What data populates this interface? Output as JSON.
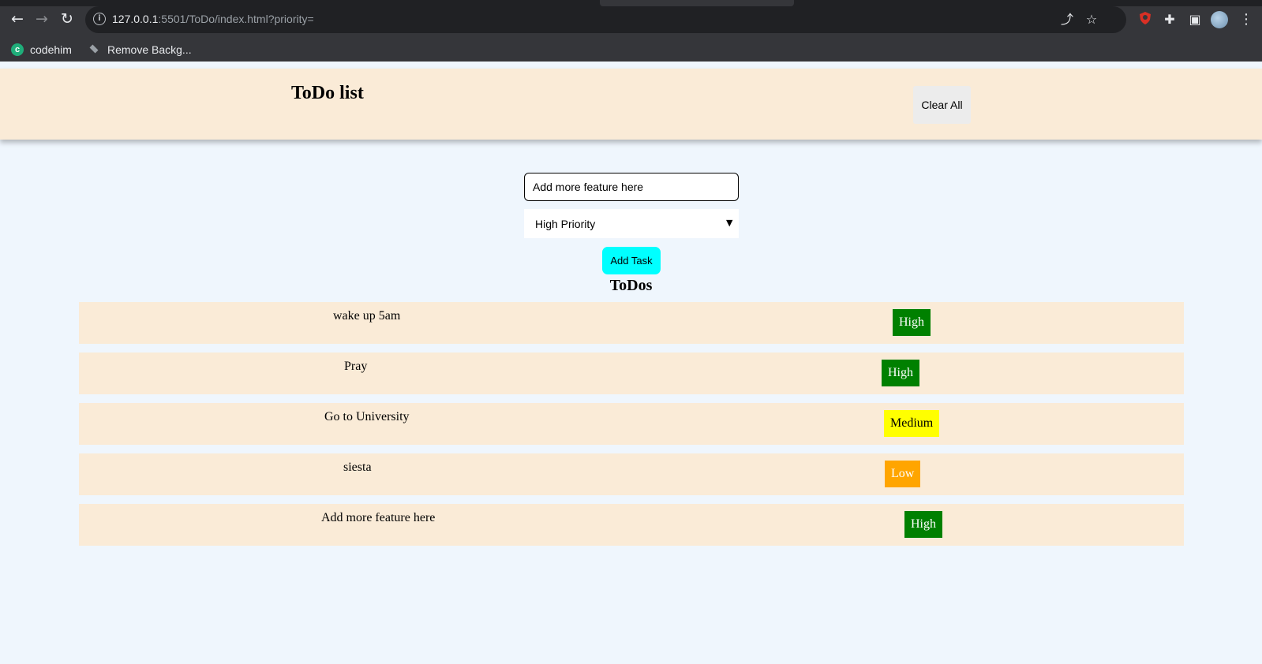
{
  "browser": {
    "url_host": "127.0.0.1",
    "url_path": ":5501/ToDo/index.html?priority=",
    "bookmarks": [
      {
        "label": "codehim",
        "icon": "codehim-logo-icon"
      },
      {
        "label": "Remove Backg...",
        "icon": "layers-icon"
      }
    ],
    "icons": {
      "back": "←",
      "forward": "→",
      "reload": "↻",
      "info": "i",
      "share": "⤴",
      "star": "☆",
      "extension_puzzle": "✚",
      "sidepanel": "▣",
      "menu": "⋮"
    }
  },
  "header": {
    "title": "ToDo list",
    "clear_label": "Clear All"
  },
  "form": {
    "input_value": "Add more feature here",
    "priority_selected": "High Priority",
    "add_label": "Add Task"
  },
  "list": {
    "heading": "ToDos",
    "items": [
      {
        "text": "wake up 5am",
        "priority": "High",
        "color": "#008000"
      },
      {
        "text": "Pray",
        "priority": "High",
        "color": "#008000"
      },
      {
        "text": "Go to University",
        "priority": "Medium",
        "color": "#ffff00"
      },
      {
        "text": "siesta",
        "priority": "Low",
        "color": "#ffa500"
      },
      {
        "text": "Add more feature here",
        "priority": "High",
        "color": "#008000"
      }
    ]
  },
  "colors": {
    "header_bg": "#faebd7",
    "page_bg": "#eff6fd",
    "add_button": "#00ffff",
    "high": "#008000",
    "medium": "#ffff00",
    "low": "#ffa500"
  }
}
